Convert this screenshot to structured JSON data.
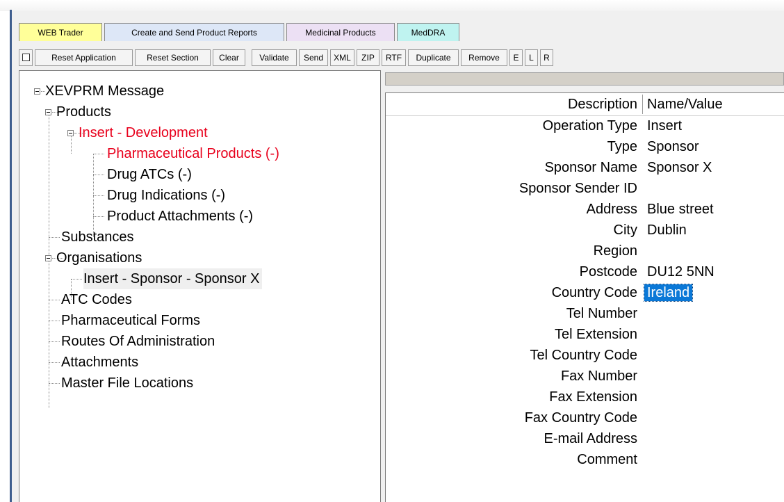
{
  "tabs": [
    {
      "label": "WEB Trader"
    },
    {
      "label": "Create and Send Product Reports"
    },
    {
      "label": "Medicinal Products"
    },
    {
      "label": "MedDRA"
    }
  ],
  "toolbar": {
    "checkbox_icon": "checkbox-icon",
    "buttons": [
      {
        "label": "Reset Application"
      },
      {
        "label": "Reset Section"
      },
      {
        "label": "Clear"
      },
      {
        "label": "Validate"
      },
      {
        "label": "Send"
      },
      {
        "label": "XML"
      },
      {
        "label": "ZIP"
      },
      {
        "label": "RTF"
      },
      {
        "label": "Duplicate"
      },
      {
        "label": "Remove"
      },
      {
        "label": "E"
      },
      {
        "label": "L"
      },
      {
        "label": "R"
      }
    ]
  },
  "tree": {
    "root": "XEVPRM Message",
    "products": "Products",
    "insert_development": "Insert - Development",
    "pharmaceutical_products": "Pharmaceutical Products (-)",
    "drug_atcs": "Drug ATCs (-)",
    "drug_indications": "Drug Indications (-)",
    "product_attachments": "Product Attachments (-)",
    "substances": "Substances",
    "organisations": "Organisations",
    "insert_sponsor": "Insert - Sponsor - Sponsor X",
    "atc_codes": "ATC Codes",
    "pharmaceutical_forms": "Pharmaceutical Forms",
    "routes_of_administration": "Routes Of Administration",
    "attachments": "Attachments",
    "master_file_locations": "Master File Locations",
    "highlight_color": "#e8001c"
  },
  "grid": {
    "header_description": "Description",
    "header_value": "Name/Value",
    "rows": [
      {
        "label": "Operation Type",
        "value": "Insert"
      },
      {
        "label": "Type",
        "value": "Sponsor"
      },
      {
        "label": "Sponsor Name",
        "value": "Sponsor X"
      },
      {
        "label": "Sponsor Sender ID",
        "value": ""
      },
      {
        "label": "Address",
        "value": "Blue street"
      },
      {
        "label": "City",
        "value": "Dublin"
      },
      {
        "label": "Region",
        "value": ""
      },
      {
        "label": "Postcode",
        "value": "DU12 5NN"
      },
      {
        "label": "Country Code",
        "value": "Ireland"
      },
      {
        "label": "Tel Number",
        "value": ""
      },
      {
        "label": "Tel Extension",
        "value": ""
      },
      {
        "label": "Tel Country Code",
        "value": ""
      },
      {
        "label": "Fax Number",
        "value": ""
      },
      {
        "label": "Fax Extension",
        "value": ""
      },
      {
        "label": "Fax Country Code",
        "value": ""
      },
      {
        "label": "E-mail Address",
        "value": ""
      },
      {
        "label": "Comment",
        "value": ""
      }
    ],
    "selected_value_color": "#0a78d7"
  }
}
